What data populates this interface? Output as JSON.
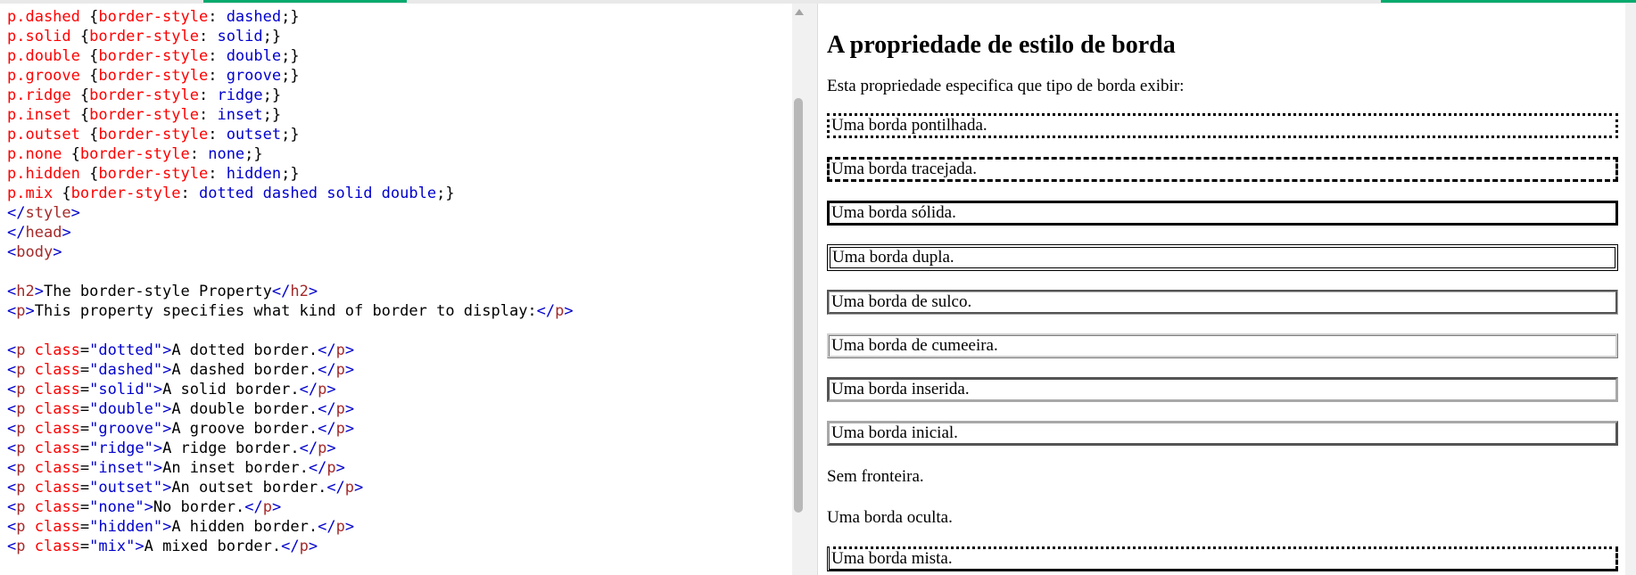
{
  "editor": {
    "lines": [
      [
        [
          "r",
          "p.dashed "
        ],
        [
          "k",
          "{"
        ],
        [
          "r",
          "border-style"
        ],
        [
          "k",
          ": "
        ],
        [
          "b",
          "dashed"
        ],
        [
          "k",
          ";}"
        ]
      ],
      [
        [
          "r",
          "p.solid "
        ],
        [
          "k",
          "{"
        ],
        [
          "r",
          "border-style"
        ],
        [
          "k",
          ": "
        ],
        [
          "b",
          "solid"
        ],
        [
          "k",
          ";}"
        ]
      ],
      [
        [
          "r",
          "p.double "
        ],
        [
          "k",
          "{"
        ],
        [
          "r",
          "border-style"
        ],
        [
          "k",
          ": "
        ],
        [
          "b",
          "double"
        ],
        [
          "k",
          ";}"
        ]
      ],
      [
        [
          "r",
          "p.groove "
        ],
        [
          "k",
          "{"
        ],
        [
          "r",
          "border-style"
        ],
        [
          "k",
          ": "
        ],
        [
          "b",
          "groove"
        ],
        [
          "k",
          ";}"
        ]
      ],
      [
        [
          "r",
          "p.ridge "
        ],
        [
          "k",
          "{"
        ],
        [
          "r",
          "border-style"
        ],
        [
          "k",
          ": "
        ],
        [
          "b",
          "ridge"
        ],
        [
          "k",
          ";}"
        ]
      ],
      [
        [
          "r",
          "p.inset "
        ],
        [
          "k",
          "{"
        ],
        [
          "r",
          "border-style"
        ],
        [
          "k",
          ": "
        ],
        [
          "b",
          "inset"
        ],
        [
          "k",
          ";}"
        ]
      ],
      [
        [
          "r",
          "p.outset "
        ],
        [
          "k",
          "{"
        ],
        [
          "r",
          "border-style"
        ],
        [
          "k",
          ": "
        ],
        [
          "b",
          "outset"
        ],
        [
          "k",
          ";}"
        ]
      ],
      [
        [
          "r",
          "p.none "
        ],
        [
          "k",
          "{"
        ],
        [
          "r",
          "border-style"
        ],
        [
          "k",
          ": "
        ],
        [
          "b",
          "none"
        ],
        [
          "k",
          ";}"
        ]
      ],
      [
        [
          "r",
          "p.hidden "
        ],
        [
          "k",
          "{"
        ],
        [
          "r",
          "border-style"
        ],
        [
          "k",
          ": "
        ],
        [
          "b",
          "hidden"
        ],
        [
          "k",
          ";}"
        ]
      ],
      [
        [
          "r",
          "p.mix "
        ],
        [
          "k",
          "{"
        ],
        [
          "r",
          "border-style"
        ],
        [
          "k",
          ": "
        ],
        [
          "b",
          "dotted dashed solid double"
        ],
        [
          "k",
          ";}"
        ]
      ],
      [
        [
          "b",
          "</"
        ],
        [
          "t",
          "style"
        ],
        [
          "b",
          ">"
        ]
      ],
      [
        [
          "b",
          "</"
        ],
        [
          "t",
          "head"
        ],
        [
          "b",
          ">"
        ]
      ],
      [
        [
          "b",
          "<"
        ],
        [
          "t",
          "body"
        ],
        [
          "b",
          ">"
        ]
      ],
      [],
      [
        [
          "b",
          "<"
        ],
        [
          "t",
          "h2"
        ],
        [
          "b",
          ">"
        ],
        [
          "k",
          "The border-style Property"
        ],
        [
          "b",
          "</"
        ],
        [
          "t",
          "h2"
        ],
        [
          "b",
          ">"
        ]
      ],
      [
        [
          "b",
          "<"
        ],
        [
          "t",
          "p"
        ],
        [
          "b",
          ">"
        ],
        [
          "k",
          "This property specifies what kind of border to display:"
        ],
        [
          "b",
          "</"
        ],
        [
          "t",
          "p"
        ],
        [
          "b",
          ">"
        ]
      ],
      [],
      [
        [
          "b",
          "<"
        ],
        [
          "t",
          "p "
        ],
        [
          "r",
          "class"
        ],
        [
          "k",
          "="
        ],
        [
          "b",
          "\"dotted\""
        ],
        [
          "b",
          ">"
        ],
        [
          "k",
          "A dotted border."
        ],
        [
          "b",
          "</"
        ],
        [
          "t",
          "p"
        ],
        [
          "b",
          ">"
        ]
      ],
      [
        [
          "b",
          "<"
        ],
        [
          "t",
          "p "
        ],
        [
          "r",
          "class"
        ],
        [
          "k",
          "="
        ],
        [
          "b",
          "\"dashed\""
        ],
        [
          "b",
          ">"
        ],
        [
          "k",
          "A dashed border."
        ],
        [
          "b",
          "</"
        ],
        [
          "t",
          "p"
        ],
        [
          "b",
          ">"
        ]
      ],
      [
        [
          "b",
          "<"
        ],
        [
          "t",
          "p "
        ],
        [
          "r",
          "class"
        ],
        [
          "k",
          "="
        ],
        [
          "b",
          "\"solid\""
        ],
        [
          "b",
          ">"
        ],
        [
          "k",
          "A solid border."
        ],
        [
          "b",
          "</"
        ],
        [
          "t",
          "p"
        ],
        [
          "b",
          ">"
        ]
      ],
      [
        [
          "b",
          "<"
        ],
        [
          "t",
          "p "
        ],
        [
          "r",
          "class"
        ],
        [
          "k",
          "="
        ],
        [
          "b",
          "\"double\""
        ],
        [
          "b",
          ">"
        ],
        [
          "k",
          "A double border."
        ],
        [
          "b",
          "</"
        ],
        [
          "t",
          "p"
        ],
        [
          "b",
          ">"
        ]
      ],
      [
        [
          "b",
          "<"
        ],
        [
          "t",
          "p "
        ],
        [
          "r",
          "class"
        ],
        [
          "k",
          "="
        ],
        [
          "b",
          "\"groove\""
        ],
        [
          "b",
          ">"
        ],
        [
          "k",
          "A groove border."
        ],
        [
          "b",
          "</"
        ],
        [
          "t",
          "p"
        ],
        [
          "b",
          ">"
        ]
      ],
      [
        [
          "b",
          "<"
        ],
        [
          "t",
          "p "
        ],
        [
          "r",
          "class"
        ],
        [
          "k",
          "="
        ],
        [
          "b",
          "\"ridge\""
        ],
        [
          "b",
          ">"
        ],
        [
          "k",
          "A ridge border."
        ],
        [
          "b",
          "</"
        ],
        [
          "t",
          "p"
        ],
        [
          "b",
          ">"
        ]
      ],
      [
        [
          "b",
          "<"
        ],
        [
          "t",
          "p "
        ],
        [
          "r",
          "class"
        ],
        [
          "k",
          "="
        ],
        [
          "b",
          "\"inset\""
        ],
        [
          "b",
          ">"
        ],
        [
          "k",
          "An inset border."
        ],
        [
          "b",
          "</"
        ],
        [
          "t",
          "p"
        ],
        [
          "b",
          ">"
        ]
      ],
      [
        [
          "b",
          "<"
        ],
        [
          "t",
          "p "
        ],
        [
          "r",
          "class"
        ],
        [
          "k",
          "="
        ],
        [
          "b",
          "\"outset\""
        ],
        [
          "b",
          ">"
        ],
        [
          "k",
          "An outset border."
        ],
        [
          "b",
          "</"
        ],
        [
          "t",
          "p"
        ],
        [
          "b",
          ">"
        ]
      ],
      [
        [
          "b",
          "<"
        ],
        [
          "t",
          "p "
        ],
        [
          "r",
          "class"
        ],
        [
          "k",
          "="
        ],
        [
          "b",
          "\"none\""
        ],
        [
          "b",
          ">"
        ],
        [
          "k",
          "No border."
        ],
        [
          "b",
          "</"
        ],
        [
          "t",
          "p"
        ],
        [
          "b",
          ">"
        ]
      ],
      [
        [
          "b",
          "<"
        ],
        [
          "t",
          "p "
        ],
        [
          "r",
          "class"
        ],
        [
          "k",
          "="
        ],
        [
          "b",
          "\"hidden\""
        ],
        [
          "b",
          ">"
        ],
        [
          "k",
          "A hidden border."
        ],
        [
          "b",
          "</"
        ],
        [
          "t",
          "p"
        ],
        [
          "b",
          ">"
        ]
      ],
      [
        [
          "b",
          "<"
        ],
        [
          "t",
          "p "
        ],
        [
          "r",
          "class"
        ],
        [
          "k",
          "="
        ],
        [
          "b",
          "\"mix\""
        ],
        [
          "b",
          ">"
        ],
        [
          "k",
          "A mixed border."
        ],
        [
          "b",
          "</"
        ],
        [
          "t",
          "p"
        ],
        [
          "b",
          ">"
        ]
      ]
    ]
  },
  "preview": {
    "heading": "A propriedade de estilo de borda",
    "intro": "Esta propriedade especifica que tipo de borda exibir:",
    "paragraphs": [
      {
        "style": "dotted",
        "text": "Uma borda pontilhada."
      },
      {
        "style": "dashed",
        "text": "Uma borda tracejada."
      },
      {
        "style": "solid",
        "text": "Uma borda sólida."
      },
      {
        "style": "double",
        "text": "Uma borda dupla."
      },
      {
        "style": "groove",
        "text": "Uma borda de sulco."
      },
      {
        "style": "ridge",
        "text": "Uma borda de cumeeira."
      },
      {
        "style": "inset",
        "text": "Uma borda inserida."
      },
      {
        "style": "outset",
        "text": "Uma borda inicial."
      },
      {
        "style": "none",
        "text": "Sem fronteira."
      },
      {
        "style": "hidden",
        "text": "Uma borda oculta."
      },
      {
        "style": "mix",
        "text": "Uma borda mista."
      }
    ]
  },
  "colors": {
    "accent": "#04aa6d",
    "code_tag": "#a52a2a",
    "code_value": "#0000cd",
    "code_property": "#ff0000"
  },
  "icons": {
    "scroll_up": "triangle-up-icon"
  }
}
